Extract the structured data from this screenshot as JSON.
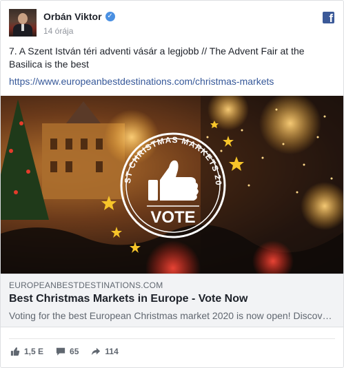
{
  "post": {
    "author": "Orbán Viktor",
    "time": "14 órája",
    "text": "7. A Szent István téri adventi vásár a legjobb // The Advent Fair at the Basilica is the best",
    "url": "https://www.europeanbestdestinations.com/christmas-markets"
  },
  "image": {
    "badge_arc_text": "BEST CHRISTMAS MARKETS 2020",
    "badge_label": "VOTE"
  },
  "preview": {
    "domain": "EUROPEANBESTDESTINATIONS.COM",
    "title": "Best Christmas Markets in Europe - Vote Now",
    "description": "Voting for the best European Christmas market 2020 is now open! Discov…"
  },
  "stats": {
    "likes": "1,5 E",
    "comments": "65",
    "shares": "114"
  },
  "icons": {
    "brand": "facebook-icon",
    "verified": "verified-badge-icon",
    "like": "thumbs-up-icon",
    "comment": "comment-icon",
    "share": "share-arrow-icon"
  },
  "colors": {
    "link": "#365899",
    "verified": "#4a90e2",
    "facebook": "#3b5998",
    "muted": "#90949c"
  }
}
